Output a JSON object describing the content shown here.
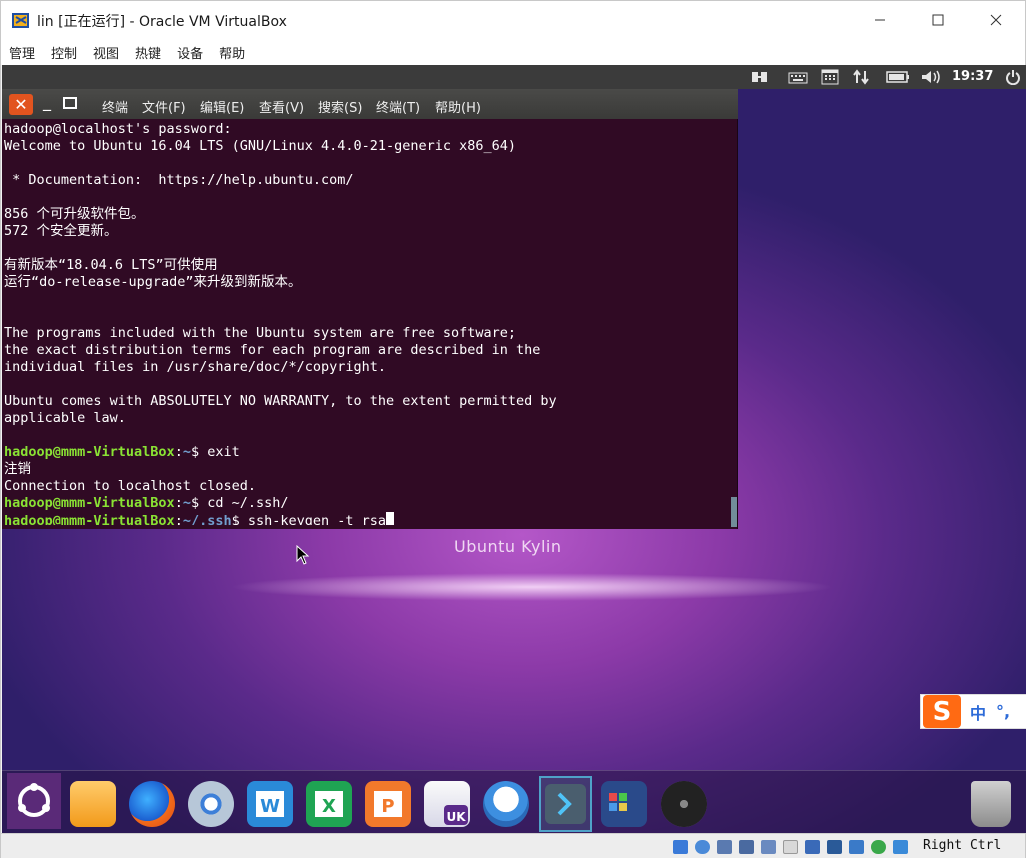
{
  "window": {
    "title": "lin [正在运行] - Oracle VM VirtualBox",
    "menu": [
      "管理",
      "控制",
      "视图",
      "热键",
      "设备",
      "帮助"
    ]
  },
  "vm_topbar": {
    "clock": "19:37"
  },
  "terminal": {
    "menu": [
      "终端",
      "文件(F)",
      "编辑(E)",
      "查看(V)",
      "搜索(S)",
      "终端(T)",
      "帮助(H)"
    ],
    "lines": [
      "hadoop@localhost's password:",
      "Welcome to Ubuntu 16.04 LTS (GNU/Linux 4.4.0-21-generic x86_64)",
      "",
      " * Documentation:  https://help.ubuntu.com/",
      "",
      "856 个可升级软件包。",
      "572 个安全更新。",
      "",
      "有新版本“18.04.6 LTS”可供使用",
      "运行“do-release-upgrade”来升级到新版本。",
      "",
      "",
      "The programs included with the Ubuntu system are free software;",
      "the exact distribution terms for each program are described in the",
      "individual files in /usr/share/doc/*/copyright.",
      "",
      "Ubuntu comes with ABSOLUTELY NO WARRANTY, to the extent permitted by",
      "applicable law.",
      ""
    ],
    "prompt_user": "hadoop@mmm-VirtualBox",
    "prompt_home": "~",
    "prompt_ssh": "~/.ssh",
    "cmd1": "exit",
    "logout_text": "注销",
    "closed_text": "Connection to localhost closed.",
    "cmd2": "cd ~/.ssh/",
    "cmd3": "ssh-keygen -t rsa"
  },
  "desktop": {
    "label": "Ubuntu Kylin"
  },
  "ime": {
    "mode": "中",
    "punct": "°,"
  },
  "dock": {
    "icons": [
      "dash-icon",
      "files-icon",
      "firefox-icon",
      "chromium-icon",
      "wps-writer-icon",
      "wps-spreadsheet-icon",
      "wps-presentation-icon",
      "kylin-software-center-icon",
      "youker-assistant-icon",
      "terminal-icon",
      "workspace-switcher-icon",
      "dvd-icon",
      "trash-icon"
    ]
  },
  "statusbar": {
    "host_key": "Right Ctrl"
  },
  "colors": {
    "terminal_bg": "#300a24",
    "prompt_green": "#8ae234",
    "prompt_blue": "#729fcf",
    "close_orange": "#e2541f"
  }
}
